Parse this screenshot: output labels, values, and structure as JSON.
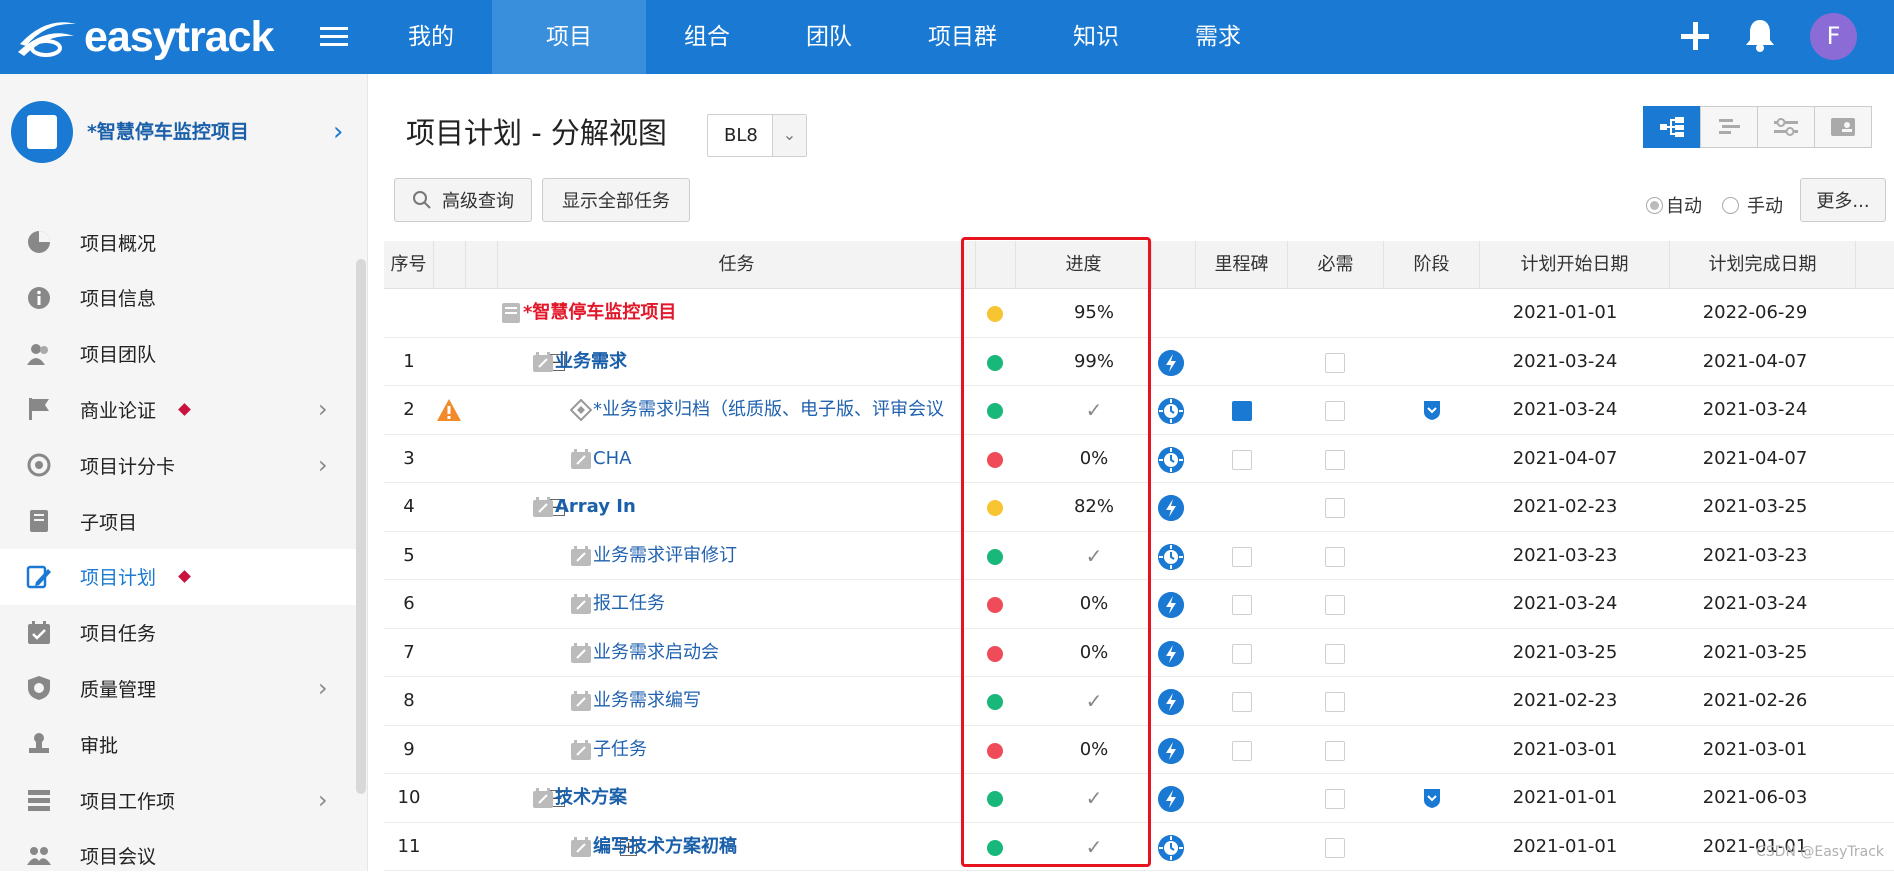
{
  "app": {
    "logo_text": "easytrack",
    "nav": [
      "我的",
      "项目",
      "组合",
      "团队",
      "项目群",
      "知识",
      "需求"
    ],
    "nav_active_index": 1,
    "avatar_letter": "F",
    "brand_color": "#1a79d2"
  },
  "sidebar": {
    "project_name": "*智慧停车监控项目",
    "items": [
      {
        "label": "项目概况",
        "icon": "pie-chart-icon",
        "chevron": false,
        "dot": false,
        "active": false
      },
      {
        "label": "项目信息",
        "icon": "info-icon",
        "chevron": false,
        "dot": false,
        "active": false
      },
      {
        "label": "项目团队",
        "icon": "team-icon",
        "chevron": false,
        "dot": false,
        "active": false
      },
      {
        "label": "商业论证",
        "icon": "flag-icon",
        "chevron": true,
        "dot": true,
        "active": false
      },
      {
        "label": "项目计分卡",
        "icon": "target-icon",
        "chevron": true,
        "dot": false,
        "active": false
      },
      {
        "label": "子项目",
        "icon": "book-icon",
        "chevron": false,
        "dot": false,
        "active": false
      },
      {
        "label": "项目计划",
        "icon": "plan-edit-icon",
        "chevron": false,
        "dot": true,
        "active": true
      },
      {
        "label": "项目任务",
        "icon": "calendar-check-icon",
        "chevron": false,
        "dot": false,
        "active": false
      },
      {
        "label": "质量管理",
        "icon": "shield-icon",
        "chevron": true,
        "dot": false,
        "active": false
      },
      {
        "label": "审批",
        "icon": "stamp-icon",
        "chevron": false,
        "dot": false,
        "active": false
      },
      {
        "label": "项目工作项",
        "icon": "list-icon",
        "chevron": true,
        "dot": false,
        "active": false
      },
      {
        "label": "项目会议",
        "icon": "meeting-icon",
        "chevron": false,
        "dot": false,
        "active": false
      }
    ]
  },
  "main": {
    "title": "项目计划 - 分解视图",
    "baseline": "BL8",
    "buttons": {
      "advanced_search": "高级查询",
      "show_all": "显示全部任务",
      "more": "更多..."
    },
    "radio_auto": "自动",
    "radio_manual": "手动",
    "radio_selected": "自动"
  },
  "table": {
    "headers": {
      "num": "序号",
      "task": "任务",
      "progress": "进度",
      "milestone": "里程碑",
      "required": "必需",
      "phase": "阶段",
      "start": "计划开始日期",
      "finish": "计划完成日期"
    },
    "rows": [
      {
        "num": "",
        "name": "*智慧停车监控项目",
        "style": "root",
        "level": 0,
        "toggle": "",
        "status": "yellow",
        "progress": "95%",
        "type": "",
        "milestone": null,
        "required": false,
        "phase": false,
        "warn": false,
        "start": "2021-01-01",
        "finish": "2022-06-29"
      },
      {
        "num": "1",
        "name": "业务需求",
        "style": "bold",
        "level": 1,
        "toggle": "−",
        "status": "green",
        "progress": "99%",
        "type": "bolt",
        "milestone": null,
        "required": true,
        "phase": false,
        "warn": false,
        "start": "2021-03-24",
        "finish": "2021-04-07"
      },
      {
        "num": "2",
        "name": "*业务需求归档（纸质版、电子版、评审会议",
        "style": "normal",
        "level": 2,
        "toggle": "",
        "status": "green",
        "progress": "✓",
        "type": "clock",
        "milestone": true,
        "required": true,
        "phase": true,
        "warn": true,
        "start": "2021-03-24",
        "finish": "2021-03-24"
      },
      {
        "num": "3",
        "name": "CHA",
        "style": "normal",
        "level": 2,
        "toggle": "",
        "status": "red",
        "progress": "0%",
        "type": "clock",
        "milestone": false,
        "required": true,
        "phase": false,
        "warn": false,
        "start": "2021-04-07",
        "finish": "2021-04-07"
      },
      {
        "num": "4",
        "name": "Array In",
        "style": "bold",
        "level": 1,
        "toggle": "−",
        "status": "yellow",
        "progress": "82%",
        "type": "bolt",
        "milestone": null,
        "required": true,
        "phase": false,
        "warn": false,
        "start": "2021-02-23",
        "finish": "2021-03-25"
      },
      {
        "num": "5",
        "name": "业务需求评审修订",
        "style": "normal",
        "level": 2,
        "toggle": "",
        "status": "green",
        "progress": "✓",
        "type": "clock",
        "milestone": false,
        "required": true,
        "phase": false,
        "warn": false,
        "start": "2021-03-23",
        "finish": "2021-03-23"
      },
      {
        "num": "6",
        "name": "报工任务",
        "style": "normal",
        "level": 2,
        "toggle": "",
        "status": "red",
        "progress": "0%",
        "type": "bolt",
        "milestone": false,
        "required": true,
        "phase": false,
        "warn": false,
        "start": "2021-03-24",
        "finish": "2021-03-24"
      },
      {
        "num": "7",
        "name": "业务需求启动会",
        "style": "normal",
        "level": 2,
        "toggle": "",
        "status": "red",
        "progress": "0%",
        "type": "bolt",
        "milestone": false,
        "required": true,
        "phase": false,
        "warn": false,
        "start": "2021-03-25",
        "finish": "2021-03-25"
      },
      {
        "num": "8",
        "name": "业务需求编写",
        "style": "normal",
        "level": 2,
        "toggle": "",
        "status": "green",
        "progress": "✓",
        "type": "bolt",
        "milestone": false,
        "required": true,
        "phase": false,
        "warn": false,
        "start": "2021-02-23",
        "finish": "2021-02-26"
      },
      {
        "num": "9",
        "name": "子任务",
        "style": "normal",
        "level": 2,
        "toggle": "",
        "status": "red",
        "progress": "0%",
        "type": "bolt",
        "milestone": false,
        "required": true,
        "phase": false,
        "warn": false,
        "start": "2021-03-01",
        "finish": "2021-03-01"
      },
      {
        "num": "10",
        "name": "技术方案",
        "style": "bold",
        "level": 1,
        "toggle": "−",
        "status": "green",
        "progress": "✓",
        "type": "bolt",
        "milestone": null,
        "required": true,
        "phase": true,
        "warn": false,
        "start": "2021-01-01",
        "finish": "2021-06-03"
      },
      {
        "num": "11",
        "name": "编写技术方案初稿",
        "style": "bold",
        "level": 2,
        "toggle": "+",
        "status": "green",
        "progress": "✓",
        "type": "clock",
        "milestone": null,
        "required": true,
        "phase": false,
        "warn": false,
        "start": "2021-01-01",
        "finish": "2021-01-01"
      }
    ],
    "status_colors": {
      "green": "#18b77a",
      "yellow": "#f7c531",
      "red": "#f04b59"
    }
  },
  "watermark": "CSDN @EasyTrack"
}
